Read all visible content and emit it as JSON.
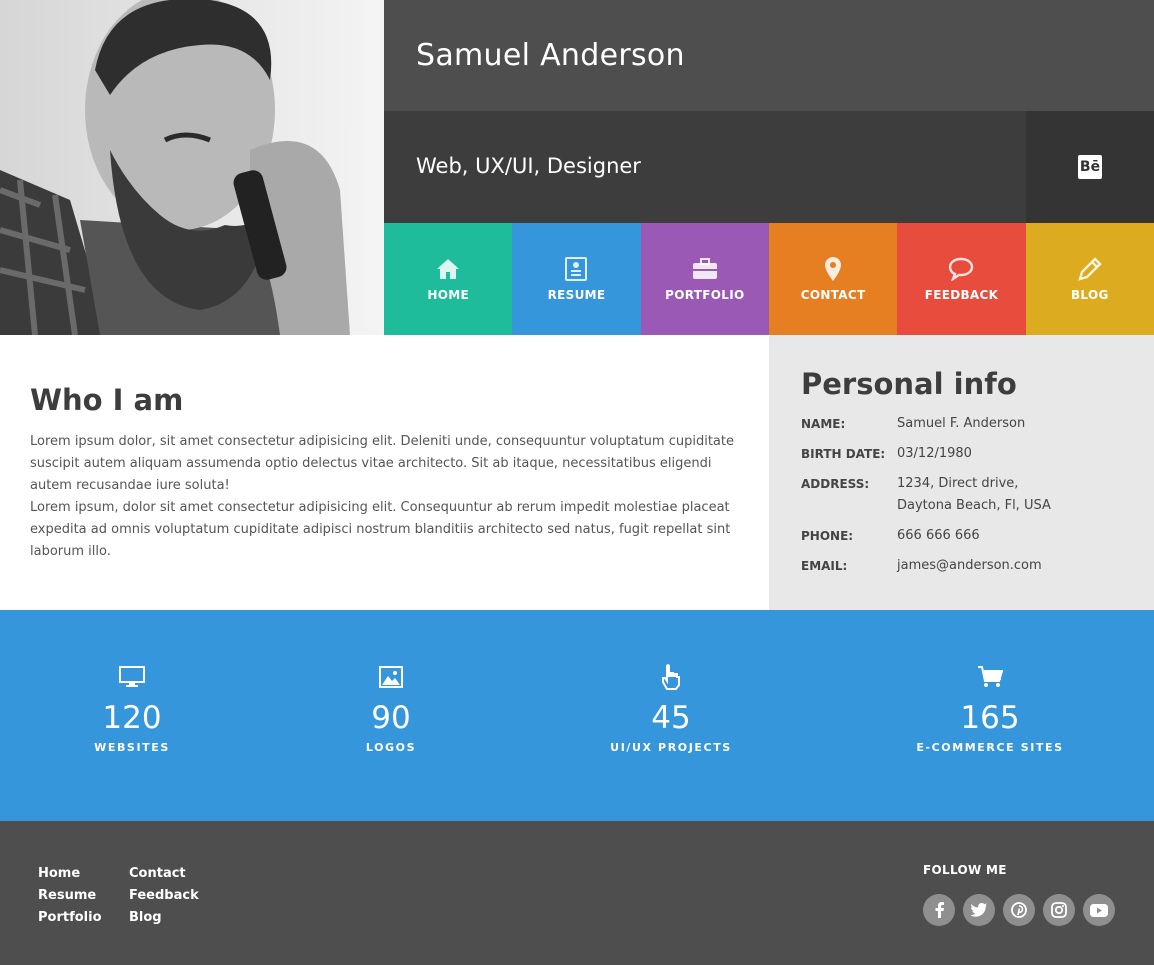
{
  "header": {
    "name": "Samuel Anderson",
    "role": "Web, UX/UI, Designer",
    "behance_icon": "behance-icon"
  },
  "nav": [
    {
      "label": "HOME",
      "icon": "home-icon",
      "color": "#1fbc9c"
    },
    {
      "label": "RESUME",
      "icon": "resume-icon",
      "color": "#3596db"
    },
    {
      "label": "PORTFOLIO",
      "icon": "briefcase-icon",
      "color": "#9a59b5"
    },
    {
      "label": "CONTACT",
      "icon": "map-pin-icon",
      "color": "#e67e22"
    },
    {
      "label": "FEEDBACK",
      "icon": "speech-bubble-icon",
      "color": "#e74c3c"
    },
    {
      "label": "BLOG",
      "icon": "pencil-icon",
      "color": "#dcab1f"
    }
  ],
  "who": {
    "title": "Who I am",
    "p1": "Lorem ipsum dolor, sit amet consectetur adipisicing elit. Deleniti unde, consequuntur voluptatum cupiditate suscipit autem aliquam assumenda optio delectus vitae architecto. Sit ab itaque, necessitatibus eligendi autem recusandae iure soluta!",
    "p2": "Lorem ipsum, dolor sit amet consectetur adipisicing elit. Consequuntur ab rerum impedit molestiae placeat expedita ad omnis voluptatum cupiditate adipisci nostrum blanditiis architecto sed natus, fugit repellat sint laborum illo."
  },
  "info": {
    "title": "Personal info",
    "rows": [
      {
        "key": "NAME:",
        "value": "Samuel F. Anderson"
      },
      {
        "key": "BIRTH DATE:",
        "value": "03/12/1980"
      },
      {
        "key": "ADDRESS:",
        "value": "1234, Direct drive,",
        "value2": "Daytona Beach, Fl, USA"
      },
      {
        "key": "PHONE:",
        "value": "666 666 666"
      },
      {
        "key": "EMAIL:",
        "value": "james@anderson.com"
      }
    ]
  },
  "stats": [
    {
      "number": "120",
      "label": "WEBSITES",
      "icon": "monitor-icon"
    },
    {
      "number": "90",
      "label": "LOGOS",
      "icon": "image-icon"
    },
    {
      "number": "45",
      "label": "UI/UX PROJECTS",
      "icon": "pointer-hand-icon"
    },
    {
      "number": "165",
      "label": "E-COMMERCE SITES",
      "icon": "cart-icon"
    }
  ],
  "footer": {
    "col1": [
      "Home",
      "Resume",
      "Portfolio"
    ],
    "col2": [
      "Contact",
      "Feedback",
      "Blog"
    ],
    "follow_label": "FOLLOW ME",
    "socials": [
      "facebook-icon",
      "twitter-icon",
      "pinterest-icon",
      "instagram-icon",
      "youtube-icon"
    ]
  },
  "colors": {
    "stats_bg": "#3596db",
    "footer_bg": "#4e4e4e",
    "name_bar_bg": "#4e4e4e",
    "role_bar_bg": "#3d3d3d"
  }
}
